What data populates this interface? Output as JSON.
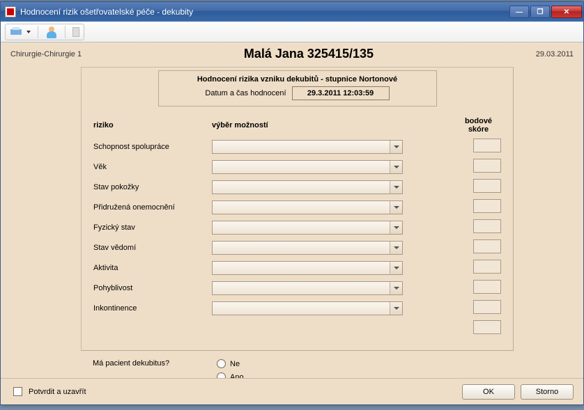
{
  "window": {
    "title": "Hodnocení rizik ošetřovatelské péče - dekubity"
  },
  "header": {
    "department": "Chirurgie-Chirurgie 1",
    "patient": "Malá Jana 325415/135",
    "date": "29.03.2011"
  },
  "assessment": {
    "title": "Hodnocení rizika vzniku dekubitů - stupnice Nortonové",
    "datetime_label": "Datum a čas hodnocení",
    "datetime_value": "29.3.2011 12:03:59"
  },
  "columns": {
    "risk": "riziko",
    "selection": "výběr možností",
    "score": "bodové skóre"
  },
  "risks": [
    {
      "label": "Schopnost spolupráce"
    },
    {
      "label": "Věk"
    },
    {
      "label": "Stav pokožky"
    },
    {
      "label": "Přidružená onemocnění"
    },
    {
      "label": "Fyzický stav"
    },
    {
      "label": "Stav vědomí"
    },
    {
      "label": "Aktivita"
    },
    {
      "label": "Pohyblivost"
    },
    {
      "label": "Inkontinence"
    }
  ],
  "question": {
    "label": "Má pacient dekubitus?",
    "options": {
      "no": "Ne",
      "yes": "Ano"
    }
  },
  "footer": {
    "confirm_close": "Potvrdit a uzavřít",
    "ok": "OK",
    "cancel": "Storno"
  }
}
